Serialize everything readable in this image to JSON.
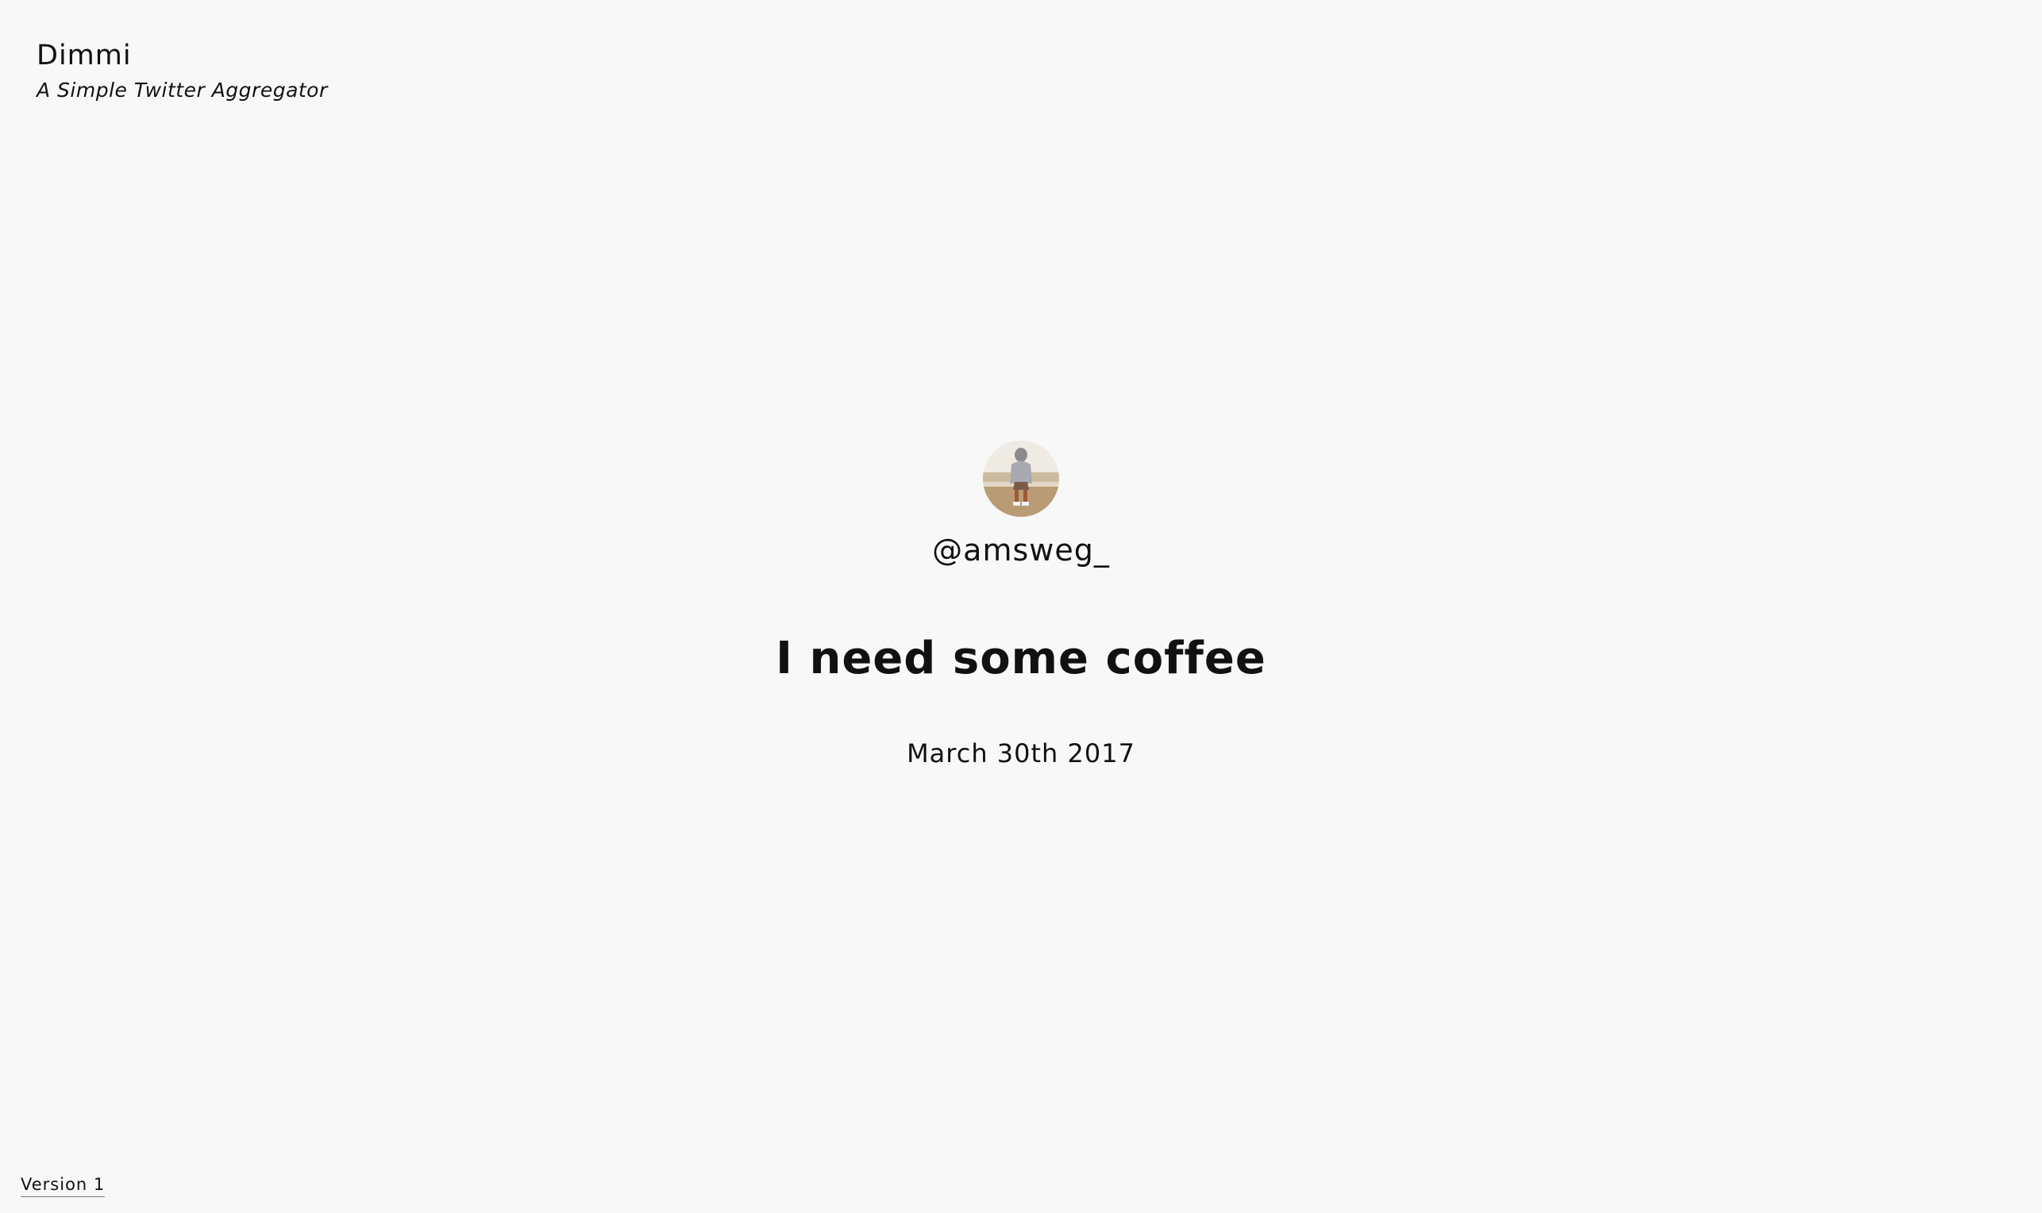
{
  "app": {
    "title": "Dimmi",
    "tagline": "A Simple Twitter Aggregator"
  },
  "tweet": {
    "avatar_icon": "user-avatar-photo",
    "handle": "@amsweg_",
    "text": "I need some coffee",
    "date": "March 30th 2017"
  },
  "footer": {
    "version_label": "Version 1"
  },
  "colors": {
    "background": "#f8f8f8",
    "text": "#111111"
  }
}
